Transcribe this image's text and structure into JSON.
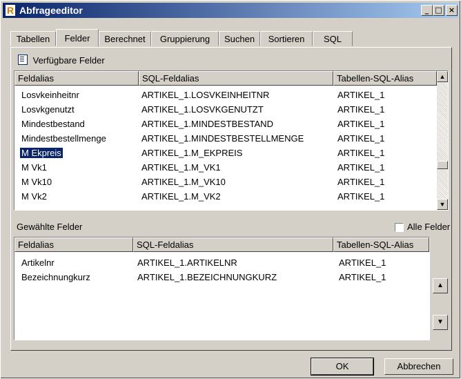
{
  "window": {
    "title": "Abfrageeditor",
    "app_icon_letter": "R"
  },
  "title_buttons": {
    "minimize": "_",
    "maximize": "□",
    "close": "×"
  },
  "tabs": [
    {
      "label": "Tabellen"
    },
    {
      "label": "Felder"
    },
    {
      "label": "Berechnet"
    },
    {
      "label": "Gruppierung"
    },
    {
      "label": "Suchen"
    },
    {
      "label": "Sortieren"
    },
    {
      "label": "SQL"
    }
  ],
  "active_tab": "Felder",
  "available": {
    "header": "Verfügbare Felder",
    "columns": [
      "Feldalias",
      "SQL-Feldalias",
      "Tabellen-SQL-Alias"
    ],
    "rows": [
      [
        "Losvkeinheitnr",
        "ARTIKEL_1.LOSVKEINHEITNR",
        "ARTIKEL_1"
      ],
      [
        "Losvkgenutzt",
        "ARTIKEL_1.LOSVKGENUTZT",
        "ARTIKEL_1"
      ],
      [
        "Mindestbestand",
        "ARTIKEL_1.MINDESTBESTAND",
        "ARTIKEL_1"
      ],
      [
        "Mindestbestellmenge",
        "ARTIKEL_1.MINDESTBESTELLMENGE",
        "ARTIKEL_1"
      ],
      [
        "M Ekpreis",
        "ARTIKEL_1.M_EKPREIS",
        "ARTIKEL_1"
      ],
      [
        "M Vk1",
        "ARTIKEL_1.M_VK1",
        "ARTIKEL_1"
      ],
      [
        "M Vk10",
        "ARTIKEL_1.M_VK10",
        "ARTIKEL_1"
      ],
      [
        "M Vk2",
        "ARTIKEL_1.M_VK2",
        "ARTIKEL_1"
      ]
    ],
    "selected_row": "M Ekpreis"
  },
  "chosen": {
    "header": "Gewählte Felder",
    "all_fields_label": "Alle Felder",
    "all_fields_checked": false,
    "columns": [
      "Feldalias",
      "SQL-Feldalias",
      "Tabellen-SQL-Alias"
    ],
    "rows": [
      [
        "Artikelnr",
        "ARTIKEL_1.ARTIKELNR",
        "ARTIKEL_1"
      ],
      [
        "Bezeichnungkurz",
        "ARTIKEL_1.BEZEICHNUNGKURZ",
        "ARTIKEL_1"
      ]
    ]
  },
  "buttons": {
    "ok": "OK",
    "cancel": "Abbrechen",
    "move_up": "▲",
    "move_down": "▼"
  },
  "scroll_arrows": {
    "up": "▲",
    "down": "▼"
  }
}
